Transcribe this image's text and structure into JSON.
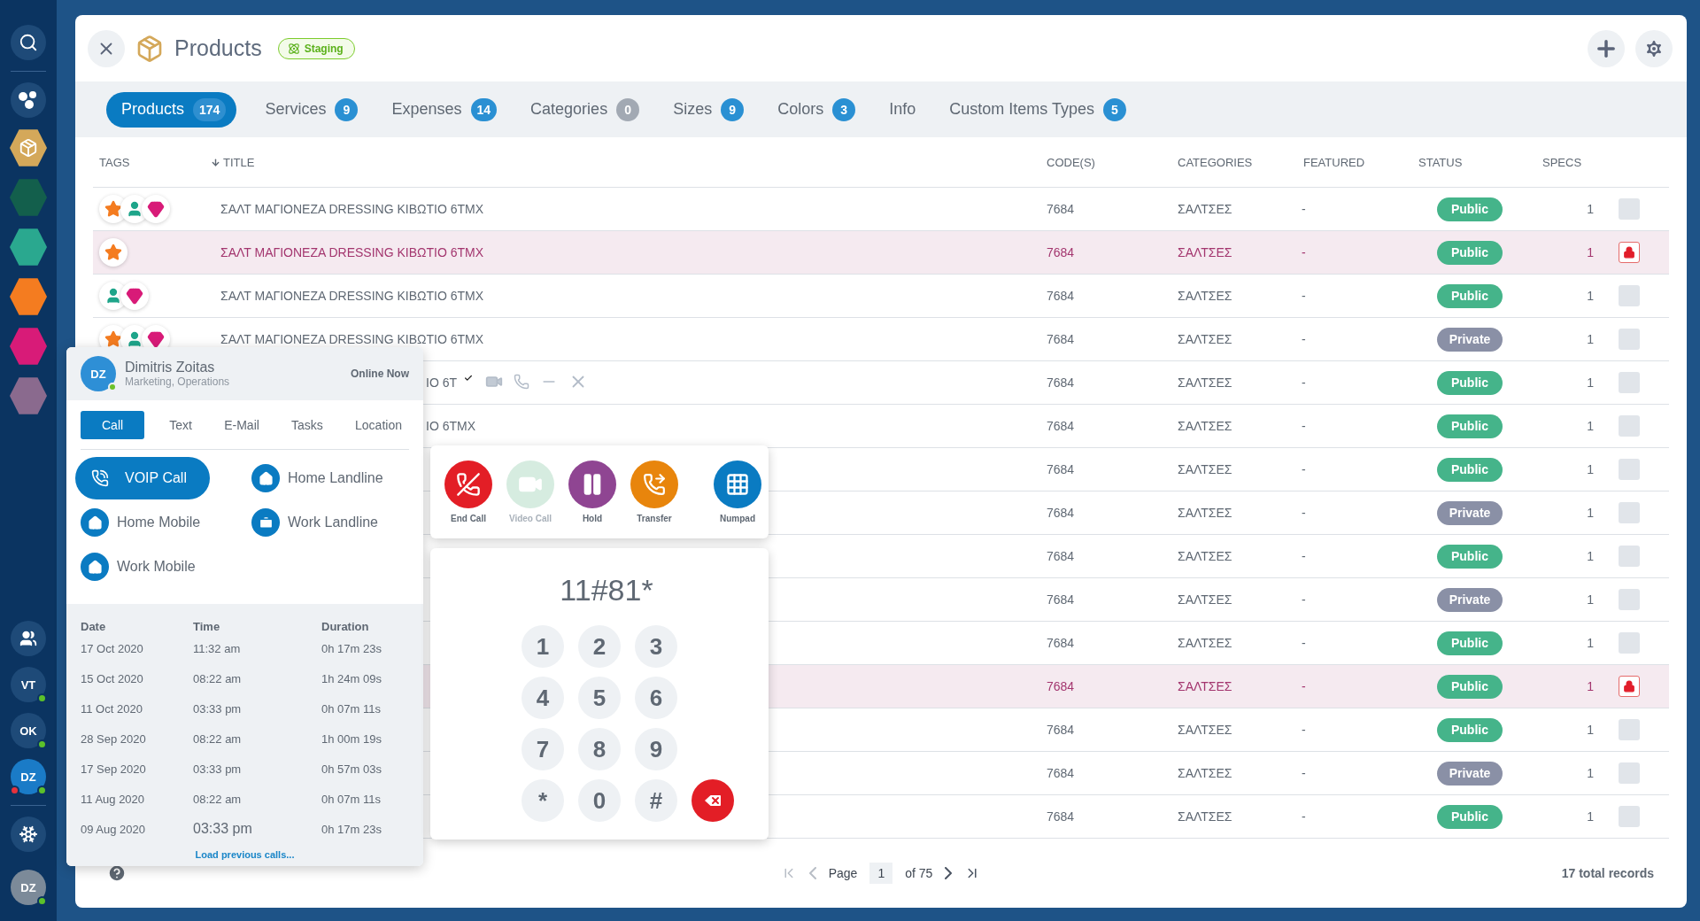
{
  "sidebar": {
    "top_items": [
      {
        "kind": "search"
      },
      {
        "kind": "apps"
      },
      {
        "kind": "module",
        "color": "#d4a85a",
        "selected": true
      },
      {
        "kind": "module",
        "color": "#135f4c",
        "selected": false
      },
      {
        "kind": "module",
        "color": "#2aa88f",
        "selected": false
      },
      {
        "kind": "module",
        "color": "#f47c20",
        "selected": false
      },
      {
        "kind": "module",
        "color": "#d81b78",
        "selected": false
      },
      {
        "kind": "module",
        "color": "#8a6a8e",
        "selected": false
      }
    ],
    "bottom_items": [
      {
        "kind": "people"
      },
      {
        "kind": "avatar",
        "initials": "VT",
        "online": true,
        "selected": false,
        "alert": false
      },
      {
        "kind": "avatar",
        "initials": "OK",
        "online": true,
        "selected": false,
        "alert": false
      },
      {
        "kind": "avatar",
        "initials": "DZ",
        "online": true,
        "selected": true,
        "alert": true
      },
      {
        "kind": "divider"
      },
      {
        "kind": "snowflake"
      }
    ],
    "user": {
      "initials": "DZ",
      "online": true
    }
  },
  "header": {
    "title": "Products",
    "badge": "Staging"
  },
  "tabs": [
    {
      "label": "Products",
      "count": "174",
      "selected": true,
      "muted": false
    },
    {
      "label": "Services",
      "count": "9",
      "selected": false,
      "muted": false
    },
    {
      "label": "Expenses",
      "count": "14",
      "selected": false,
      "muted": false
    },
    {
      "label": "Categories",
      "count": "0",
      "selected": false,
      "muted": true
    },
    {
      "label": "Sizes",
      "count": "9",
      "selected": false,
      "muted": false
    },
    {
      "label": "Colors",
      "count": "3",
      "selected": false,
      "muted": false
    },
    {
      "label": "Info",
      "selected": false
    },
    {
      "label": "Custom Items Types",
      "count": "5",
      "selected": false,
      "muted": false
    }
  ],
  "table": {
    "columns": [
      {
        "label": "TAGS",
        "sorted": false
      },
      {
        "label": "TITLE",
        "sorted": true
      },
      {
        "label": "CODE(S)",
        "sorted": false
      },
      {
        "label": "CATEGORIES",
        "sorted": false
      },
      {
        "label": "FEATURED",
        "sorted": false
      },
      {
        "label": "STATUS",
        "sorted": false
      },
      {
        "label": "SPECS",
        "sorted": false
      }
    ],
    "rows": [
      {
        "tags": [
          {
            "kind": "star"
          },
          {
            "kind": "person"
          },
          {
            "kind": "gem"
          }
        ],
        "title": "ΣΑΛΤ ΜΑΓΙΟΝΕΖΑ DRESSING ΚΙΒΩΤΙΟ 6TMX",
        "title_clipped": false,
        "code": "7684",
        "category": "ΣΑΛΤΣΕΣ",
        "featured": "-",
        "status": "Public",
        "specs": "1",
        "locked": false
      },
      {
        "tags": [
          {
            "kind": "star"
          }
        ],
        "title": "ΣΑΛΤ ΜΑΓΙΟΝΕΖΑ DRESSING ΚΙΒΩΤΙΟ 6TMX",
        "title_clipped": false,
        "code": "7684",
        "category": "ΣΑΛΤΣΕΣ",
        "featured": "-",
        "status": "Public",
        "specs": "1",
        "locked": true
      },
      {
        "tags": [
          {
            "kind": "person"
          },
          {
            "kind": "gem"
          }
        ],
        "title": "ΣΑΛΤ ΜΑΓΙΟΝΕΖΑ DRESSING ΚΙΒΩΤΙΟ 6TMX",
        "title_clipped": false,
        "code": "7684",
        "category": "ΣΑΛΤΣΕΣ",
        "featured": "-",
        "status": "Public",
        "specs": "1",
        "locked": false
      },
      {
        "tags": [
          {
            "kind": "star"
          },
          {
            "kind": "person"
          },
          {
            "kind": "gem"
          }
        ],
        "title": "ΣΑΛΤ ΜΑΓΙΟΝΕΖΑ DRESSING ΚΙΒΩΤΙΟ 6TMX",
        "title_clipped": false,
        "code": "7684",
        "category": "ΣΑΛΤΣΕΣ",
        "featured": "-",
        "status": "Private",
        "specs": "1",
        "locked": false
      },
      {
        "title": "IO 6T",
        "title_clipped": true,
        "code": "7684",
        "category": "ΣΑΛΤΣΕΣ",
        "featured": "-",
        "status": "Public",
        "specs": "1",
        "locked": false
      },
      {
        "title": "IO 6TMX",
        "title_clipped": true,
        "code": "7684",
        "category": "ΣΑΛΤΣΕΣ",
        "featured": "-",
        "status": "Public",
        "specs": "1",
        "locked": false
      },
      {
        "code": "7684",
        "category": "ΣΑΛΤΣΕΣ",
        "featured": "-",
        "status": "Public",
        "specs": "1",
        "locked": false
      },
      {
        "code": "7684",
        "category": "ΣΑΛΤΣΕΣ",
        "featured": "-",
        "status": "Private",
        "specs": "1",
        "locked": false
      },
      {
        "code": "7684",
        "category": "ΣΑΛΤΣΕΣ",
        "featured": "-",
        "status": "Public",
        "specs": "1",
        "locked": false
      },
      {
        "code": "7684",
        "category": "ΣΑΛΤΣΕΣ",
        "featured": "-",
        "status": "Private",
        "specs": "1",
        "locked": false
      },
      {
        "code": "7684",
        "category": "ΣΑΛΤΣΕΣ",
        "featured": "-",
        "status": "Public",
        "specs": "1",
        "locked": false
      },
      {
        "code": "7684",
        "category": "ΣΑΛΤΣΕΣ",
        "featured": "-",
        "status": "Public",
        "specs": "1",
        "locked": true
      },
      {
        "code": "7684",
        "category": "ΣΑΛΤΣΕΣ",
        "featured": "-",
        "status": "Public",
        "specs": "1",
        "locked": false
      },
      {
        "code": "7684",
        "category": "ΣΑΛΤΣΕΣ",
        "featured": "-",
        "status": "Private",
        "specs": "1",
        "locked": false
      },
      {
        "code": "7684",
        "category": "ΣΑΛΤΣΕΣ",
        "featured": "-",
        "status": "Public",
        "specs": "1",
        "locked": false
      }
    ]
  },
  "pagination": {
    "label": "Page",
    "page": "1",
    "of": "of 75",
    "total": "17 total records"
  },
  "contact": {
    "initials": "DZ",
    "online": true,
    "name": "Dimitris Zoitas",
    "role": "Marketing, Operations",
    "status": "Online Now",
    "tabs": [
      {
        "label": "Call",
        "selected": true
      },
      {
        "label": "Text",
        "selected": false
      },
      {
        "label": "E-Mail",
        "selected": false
      },
      {
        "label": "Tasks",
        "selected": false
      },
      {
        "label": "Location",
        "selected": false
      }
    ],
    "options": [
      {
        "label": "VOIP Call",
        "kind": "voip",
        "selected": true
      },
      {
        "label": "Home Landline",
        "kind": "home",
        "selected": false
      },
      {
        "label": "Home Mobile",
        "kind": "home",
        "selected": false
      },
      {
        "label": "Work Landline",
        "kind": "work",
        "selected": false
      },
      {
        "label": "Work Mobile",
        "kind": "home",
        "selected": false
      }
    ],
    "history": {
      "columns": [
        "Date",
        "Time",
        "Duration"
      ],
      "rows": [
        {
          "date": "17 Oct 2020",
          "time": "11:32 am",
          "duration": "0h 17m 23s",
          "hovered": false
        },
        {
          "date": "15 Oct 2020",
          "time": "08:22 am",
          "duration": "1h 24m 09s",
          "hovered": false
        },
        {
          "date": "11 Oct 2020",
          "time": "03:33 pm",
          "duration": "0h 07m 11s",
          "hovered": false
        },
        {
          "date": "28 Sep 2020",
          "time": "08:22 am",
          "duration": "1h 00m 19s",
          "hovered": false
        },
        {
          "date": "17 Sep 2020",
          "time": "03:33 pm",
          "duration": "0h 57m 03s",
          "hovered": false
        },
        {
          "date": "11 Aug 2020",
          "time": "08:22 am",
          "duration": "0h 07m 11s",
          "hovered": false
        },
        {
          "date": "09 Aug 2020",
          "time": "03:33 pm",
          "duration": "0h 17m 23s",
          "hovered": true
        }
      ]
    },
    "load_more": "Load previous calls..."
  },
  "call": {
    "controls": [
      {
        "label": "End Call",
        "kind": "end",
        "disabled": false
      },
      {
        "label": "Video Call",
        "kind": "video",
        "disabled": true
      },
      {
        "label": "Hold",
        "kind": "hold",
        "disabled": false
      },
      {
        "label": "Transfer",
        "kind": "transfer",
        "disabled": false
      },
      {
        "label": "Numpad",
        "kind": "numpad",
        "disabled": false
      }
    ],
    "display": "11#81*",
    "keys": [
      "1",
      "2",
      "3",
      "4",
      "5",
      "6",
      "7",
      "8",
      "9",
      "*",
      "0",
      "#"
    ]
  }
}
